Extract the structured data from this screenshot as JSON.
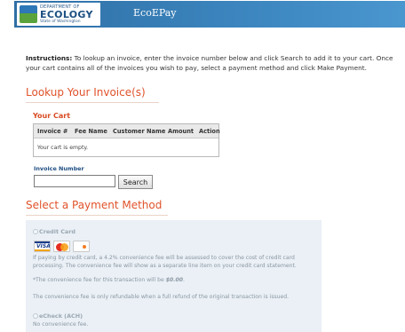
{
  "header": {
    "logo": {
      "department": "DEPARTMENT OF",
      "name": "ECOLOGY",
      "state": "State of Washington"
    },
    "app_title": "EcoEPay"
  },
  "instructions": {
    "label": "Instructions:",
    "text": " To lookup an invoice, enter the invoice number below and click Search to add it to your cart. Once your cart contains all of the invoices you wish to pay, select a payment method and click Make Payment."
  },
  "lookup": {
    "title": "Lookup Your Invoice(s)",
    "cart": {
      "title": "Your Cart",
      "columns": [
        "Invoice #",
        "Fee Name",
        "Customer Name",
        "Amount",
        "Action"
      ],
      "empty_text": "Your cart is empty."
    },
    "invoice_label": "Invoice Number",
    "invoice_value": "",
    "search_label": "Search"
  },
  "payment": {
    "title": "Select a Payment Method",
    "credit_card": {
      "label": "Credit Card",
      "cards": [
        "VISA",
        "MasterCard",
        "DISCOVER"
      ],
      "fee_text": "If paying by credit card, a 4.2% convenience fee will be assessed to cover the cost of credit card processing. The convenience fee will show as a separate line item on your credit card statement.",
      "fee_amount_prefix": "*The convenience fee for this transaction will be ",
      "fee_amount": "$0.00",
      "fee_amount_suffix": ".",
      "refund_text": "The convenience fee is only refundable when a full refund of the original transaction is issued."
    },
    "echeck": {
      "label": "eCheck (ACH)",
      "fee_text": "No convenience fee."
    }
  },
  "colors": {
    "header_blue": "#3b84bd",
    "section_orange": "#e0532a",
    "label_blue": "#1f4e82",
    "panel_bg": "#eaf0f5"
  }
}
